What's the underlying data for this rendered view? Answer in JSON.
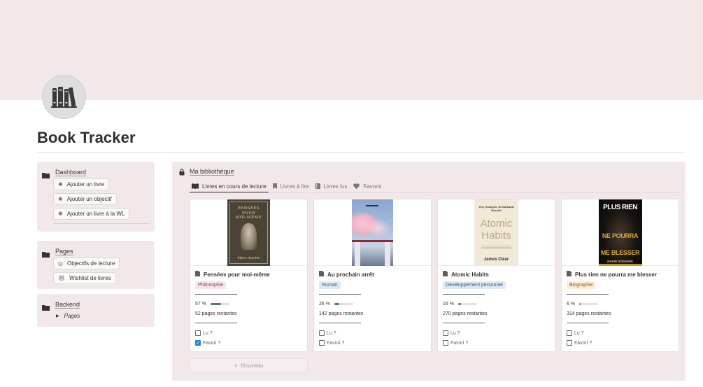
{
  "page": {
    "title": "Book Tracker",
    "icon": "books-icon"
  },
  "sidebar": {
    "dashboard": {
      "label": "Dashboard",
      "buttons": [
        {
          "label": "Ajouter un livre",
          "icon": "sparkle-icon"
        },
        {
          "label": "Ajouter un objectif",
          "icon": "sparkle-icon"
        },
        {
          "label": "Ajouter un livre à la WL",
          "icon": "sparkle-icon"
        }
      ]
    },
    "pages": {
      "label": "Pages",
      "buttons": [
        {
          "label": "Objectifs de lecture",
          "icon": "target-icon"
        },
        {
          "label": "Wishlist de livres",
          "icon": "gift-icon"
        }
      ]
    },
    "backend": {
      "label": "Backend",
      "items": [
        {
          "label": "Pages"
        }
      ]
    }
  },
  "library": {
    "title": "Ma bibliothèque",
    "tabs": [
      {
        "label": "Livres en cours de lecture",
        "icon": "open-book-icon",
        "active": true
      },
      {
        "label": "Livres à lire",
        "icon": "bookmark-icon",
        "active": false
      },
      {
        "label": "Livres lus",
        "icon": "book-icon",
        "active": false
      },
      {
        "label": "Favoris",
        "icon": "heart-icon",
        "active": false
      }
    ],
    "cards": [
      {
        "title": "Pensées pour moi-même",
        "tag": "Philosophie",
        "tag_bg": "#f9e4ec",
        "tag_fg": "#9b3a5c",
        "percent_label": "57 %",
        "percent": 0.57,
        "pages_left": "52 pages restantes",
        "read_label": "Lu ?",
        "read": false,
        "fav_label": "Favori ?",
        "fav": true,
        "cover": {
          "line1": "PENSÉES",
          "line2": "POUR",
          "line3": "MOI-MÊME",
          "author": "Marc Aurèle"
        }
      },
      {
        "title": "Au prochain arrêt",
        "tag": "Roman",
        "tag_bg": "#dde8f3",
        "tag_fg": "#2f5d86",
        "percent_label": "26 %",
        "percent": 0.26,
        "pages_left": "142 pages restantes",
        "read_label": "Lu ?",
        "read": false,
        "fav_label": "Favori ?",
        "fav": false,
        "cover": {}
      },
      {
        "title": "Atomic Habits",
        "tag": "Développement personnel",
        "tag_bg": "#dde8f3",
        "tag_fg": "#2f5d86",
        "percent_label": "16 %",
        "percent": 0.16,
        "pages_left": "270 pages restantes",
        "read_label": "Lu ?",
        "read": false,
        "fav_label": "Favori ?",
        "fav": false,
        "cover": {
          "top": "Tiny Changes, Remarkable Results",
          "word1": "Atomic",
          "word2": "Habits",
          "author": "James Clear"
        }
      },
      {
        "title": "Plus rien ne pourra me blesser",
        "tag": "Biographie",
        "tag_bg": "#fbecd4",
        "tag_fg": "#8a5a1c",
        "percent_label": "6 %",
        "percent": 0.06,
        "pages_left": "314 pages restantes",
        "read_label": "Lu ?",
        "read": false,
        "fav_label": "Favori ?",
        "fav": false,
        "cover": {
          "line1": "PLUS RIEN",
          "line2": "NE POURRA",
          "line3": "ME BLESSER",
          "author": "DAVID GOGGINS"
        }
      }
    ],
    "new_label": "Nouveau"
  }
}
